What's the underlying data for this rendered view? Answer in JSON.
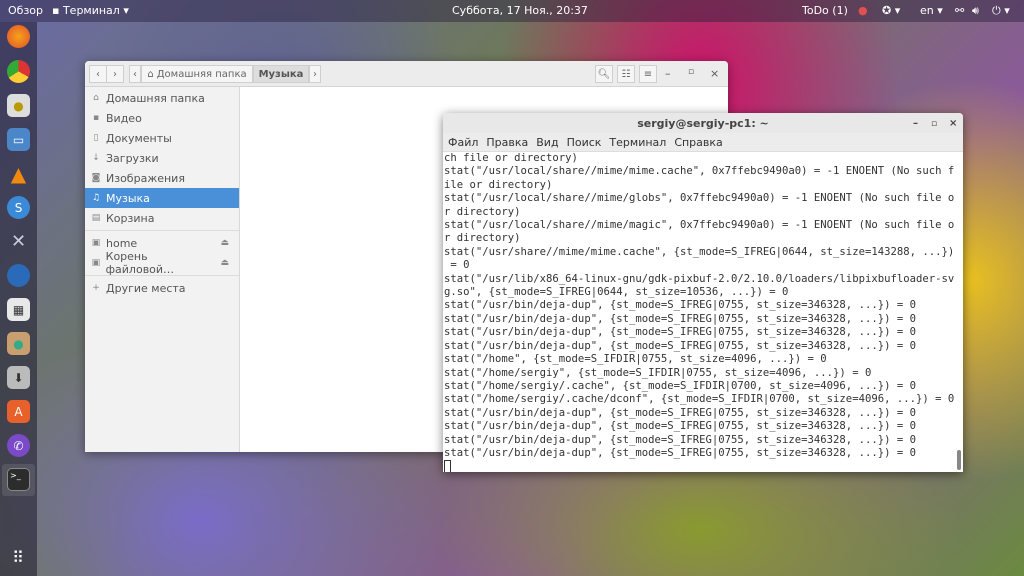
{
  "topbar": {
    "activities": "Обзор",
    "app": "Терминал ▾",
    "clock": "Суббота, 17 Ноя., 20:37",
    "todo": "ToDo (1)",
    "lang": "en ▾"
  },
  "dock": [
    "firefox",
    "chrome",
    "speaker",
    "files",
    "vlc",
    "simplenote",
    "tools",
    "thunderbird",
    "calculator",
    "archive-manager",
    "installer",
    "software-center",
    "viber",
    "terminal"
  ],
  "file_manager": {
    "path_home": "Домашняя папка",
    "path_current": "Музыка",
    "places": [
      "Домашняя папка",
      "Видео",
      "Документы",
      "Загрузки",
      "Изображения",
      "Музыка",
      "Корзина"
    ],
    "devices": [
      "home",
      "Корень файловой…"
    ],
    "other": "Другие места",
    "selected": "Музыка"
  },
  "terminal": {
    "title": "sergiy@sergiy-pc1: ~",
    "menu": [
      "Файл",
      "Правка",
      "Вид",
      "Поиск",
      "Терминал",
      "Справка"
    ],
    "lines": [
      "ch file or directory)",
      "stat(\"/usr/local/share//mime/mime.cache\", 0x7ffebc9490a0) = -1 ENOENT (No such f",
      "ile or directory)",
      "stat(\"/usr/local/share//mime/globs\", 0x7ffebc9490a0) = -1 ENOENT (No such file o",
      "r directory)",
      "stat(\"/usr/local/share//mime/magic\", 0x7ffebc9490a0) = -1 ENOENT (No such file o",
      "r directory)",
      "stat(\"/usr/share//mime/mime.cache\", {st_mode=S_IFREG|0644, st_size=143288, ...})",
      " = 0",
      "stat(\"/usr/lib/x86_64-linux-gnu/gdk-pixbuf-2.0/2.10.0/loaders/libpixbufloader-sv",
      "g.so\", {st_mode=S_IFREG|0644, st_size=10536, ...}) = 0",
      "stat(\"/usr/bin/deja-dup\", {st_mode=S_IFREG|0755, st_size=346328, ...}) = 0",
      "stat(\"/usr/bin/deja-dup\", {st_mode=S_IFREG|0755, st_size=346328, ...}) = 0",
      "stat(\"/usr/bin/deja-dup\", {st_mode=S_IFREG|0755, st_size=346328, ...}) = 0",
      "stat(\"/usr/bin/deja-dup\", {st_mode=S_IFREG|0755, st_size=346328, ...}) = 0",
      "stat(\"/home\", {st_mode=S_IFDIR|0755, st_size=4096, ...}) = 0",
      "stat(\"/home/sergiy\", {st_mode=S_IFDIR|0755, st_size=4096, ...}) = 0",
      "stat(\"/home/sergiy/.cache\", {st_mode=S_IFDIR|0700, st_size=4096, ...}) = 0",
      "stat(\"/home/sergiy/.cache/dconf\", {st_mode=S_IFDIR|0700, st_size=4096, ...}) = 0",
      "stat(\"/usr/bin/deja-dup\", {st_mode=S_IFREG|0755, st_size=346328, ...}) = 0",
      "stat(\"/usr/bin/deja-dup\", {st_mode=S_IFREG|0755, st_size=346328, ...}) = 0",
      "stat(\"/usr/bin/deja-dup\", {st_mode=S_IFREG|0755, st_size=346328, ...}) = 0",
      "stat(\"/usr/bin/deja-dup\", {st_mode=S_IFREG|0755, st_size=346328, ...}) = 0"
    ]
  }
}
